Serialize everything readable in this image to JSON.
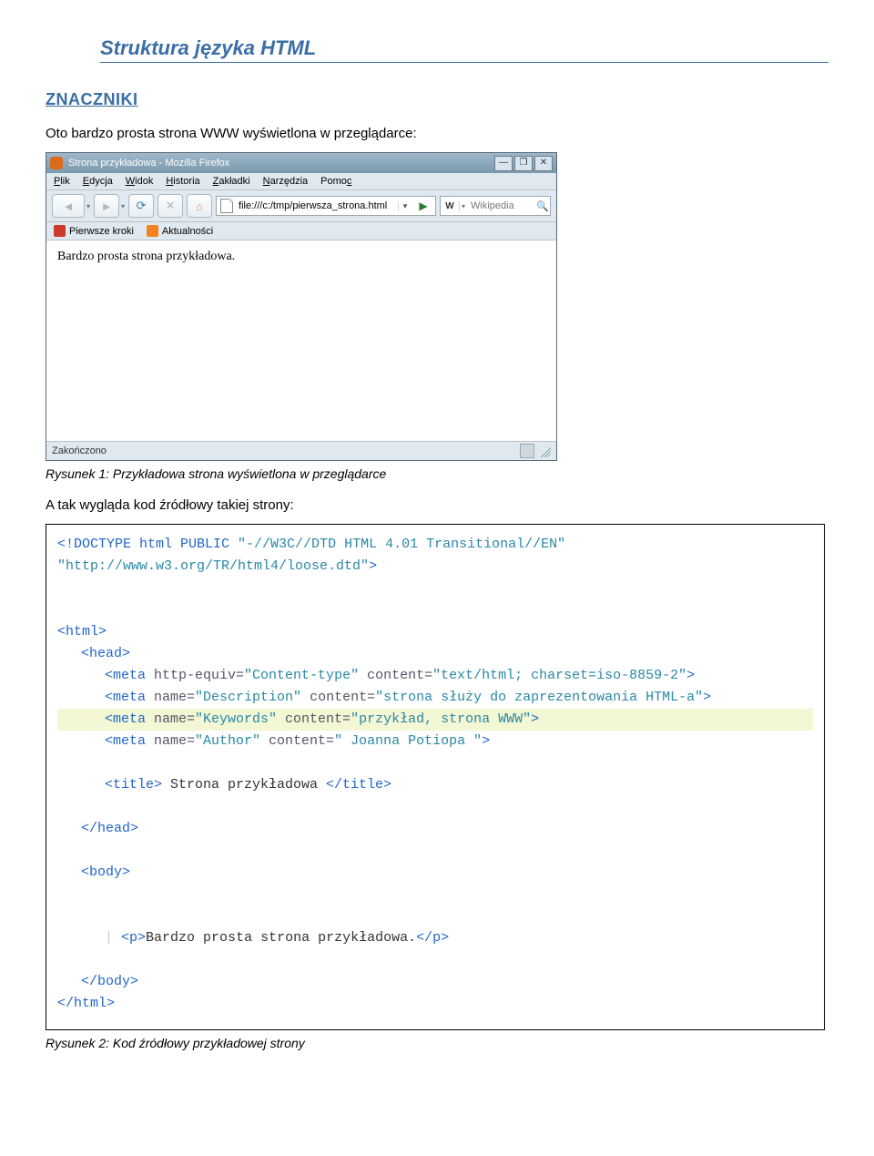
{
  "doc": {
    "title": "Struktura języka HTML",
    "heading": "ZNACZNIKI",
    "intro": "Oto bardzo prosta strona WWW wyświetlona w przeglądarce:",
    "caption1": "Rysunek 1: Przykładowa strona wyświetlona w przeglądarce",
    "mid": "A tak wygląda kod źródłowy takiej strony:",
    "caption2": "Rysunek 2: Kod źródłowy przykładowej strony"
  },
  "browser": {
    "title": "Strona przykładowa - Mozilla Firefox",
    "menus": [
      "Plik",
      "Edycja",
      "Widok",
      "Historia",
      "Zakładki",
      "Narzędzia",
      "Pomoc"
    ],
    "url": "file:///c:/tmp/pierwsza_strona.html",
    "search_engine": "W",
    "search_placeholder": "Wikipedia",
    "bookmarks": [
      {
        "icon": "red",
        "label": "Pierwsze kroki"
      },
      {
        "icon": "rss",
        "label": "Aktualności"
      }
    ],
    "page_text": "Bardzo prosta strona przykładowa.",
    "status": "Zakończono",
    "winbtns": {
      "min": "—",
      "max": "❐",
      "close": "✕"
    }
  },
  "code": {
    "l1a": "<!DOCTYPE html PUBLIC ",
    "l1b": "\"-//W3C//DTD HTML 4.01 Transitional//EN\"",
    "l2": "\"http://www.w3.org/TR/html4/loose.dtd\"",
    "l2b": ">",
    "html_o": "<html>",
    "head_o": "<head>",
    "m1a": "<meta ",
    "m1b": "http-equiv=",
    "m1c": "\"Content-type\"",
    "m1d": " content=",
    "m1e": "\"text/html; charset=iso-8859-2\"",
    "m1f": ">",
    "m2a": "<meta ",
    "m2b": "name=",
    "m2c": "\"Description\"",
    "m2d": " content=",
    "m2e": "\"strona służy do zaprezentowania HTML-a\"",
    "m2f": ">",
    "m3a": "<meta ",
    "m3b": "name=",
    "m3c": "\"Keywords\"",
    "m3d": " content=",
    "m3e": "\"przykład, strona WWW\"",
    "m3f": ">",
    "m4a": "<meta ",
    "m4b": "name=",
    "m4c": "\"Author\"",
    "m4d": " content=",
    "m4e": "\" Joanna Potiopa \"",
    "m4f": ">",
    "title_o": "<title>",
    "title_t": " Strona przykładowa ",
    "title_c": "</title>",
    "head_c": "</head>",
    "body_o": "<body>",
    "p_o": "<p>",
    "p_t": "Bardzo prosta strona przykładowa.",
    "p_c": "</p>",
    "body_c": "</body>",
    "html_c": "</html>"
  }
}
